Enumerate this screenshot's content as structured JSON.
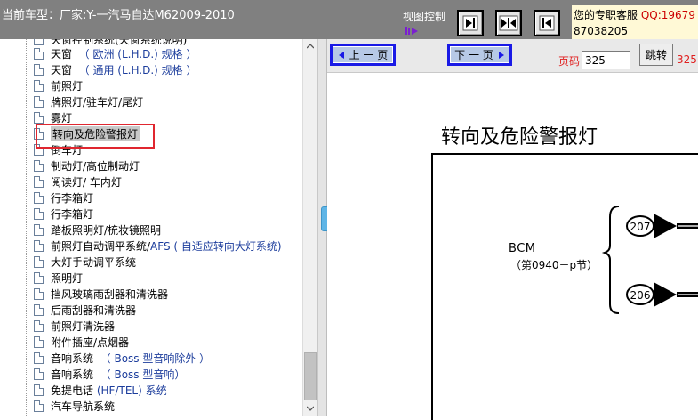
{
  "header": {
    "car_label": "当前车型：厂家:Y-一汽马自达M62009-2010",
    "view_control_label": "视图控制",
    "support_text": "您的专职客服",
    "support_qq": "QQ:19679",
    "support_tail": "87038205"
  },
  "sidebar": {
    "partial_top": "天窗控制系统(天窗系统说明)",
    "items": [
      {
        "main": "天窗",
        "extra": "（ 欧洲 (L.H.D.) 规格 ）"
      },
      {
        "main": "天窗",
        "extra": "（ 通用 (L.H.D.) 规格 ）"
      },
      {
        "main": "前照灯",
        "extra": ""
      },
      {
        "main": "牌照灯/驻车灯/尾灯",
        "extra": ""
      },
      {
        "main": "雾灯",
        "extra": ""
      },
      {
        "main": "转向及危险警报灯",
        "extra": ""
      },
      {
        "main": "倒车灯",
        "extra": ""
      },
      {
        "main": "制动灯/高位制动灯",
        "extra": ""
      },
      {
        "main": "阅读灯/ 车内灯",
        "extra": ""
      },
      {
        "main": "行李箱灯",
        "extra": ""
      },
      {
        "main": "行李箱灯",
        "extra": ""
      },
      {
        "main": "踏板照明灯/梳妆镜照明",
        "extra": ""
      },
      {
        "main": "前照灯自动调平系统/",
        "extra": "AFS ( 自适应转向大灯系统)"
      },
      {
        "main": "大灯手动调平系统",
        "extra": ""
      },
      {
        "main": "照明灯",
        "extra": ""
      },
      {
        "main": "挡风玻璃雨刮器和清洗器",
        "extra": ""
      },
      {
        "main": "后雨刮器和清洗器",
        "extra": ""
      },
      {
        "main": "前照灯清洗器",
        "extra": ""
      },
      {
        "main": "附件插座/点烟器",
        "extra": ""
      },
      {
        "main": "音响系统",
        "extra": "（ Boss 型音响除外 ）"
      },
      {
        "main": "音响系统",
        "extra": "（ Boss 型音响）"
      },
      {
        "main": "免提电话",
        "extra": "(HF/TEL) 系统"
      },
      {
        "main": "汽车导航系统",
        "extra": ""
      }
    ],
    "selected_index": 5
  },
  "toolbar": {
    "prev_label": "上 一 页",
    "next_label": "下 一 页",
    "page_label": "页码",
    "page_value": "325",
    "go_label": "跳转",
    "page_total": "325"
  },
  "diagram": {
    "title": "转向及危险警报灯",
    "bcm_label": "BCM",
    "bcm_sub": "（第0940－p节）",
    "connector_1": "207",
    "connector_2": "206"
  },
  "colors": {
    "header_bg": "#808080",
    "highlight_border": "#e0262f",
    "nav_border": "#1a1ae6",
    "accent_red": "#e01f1f"
  }
}
